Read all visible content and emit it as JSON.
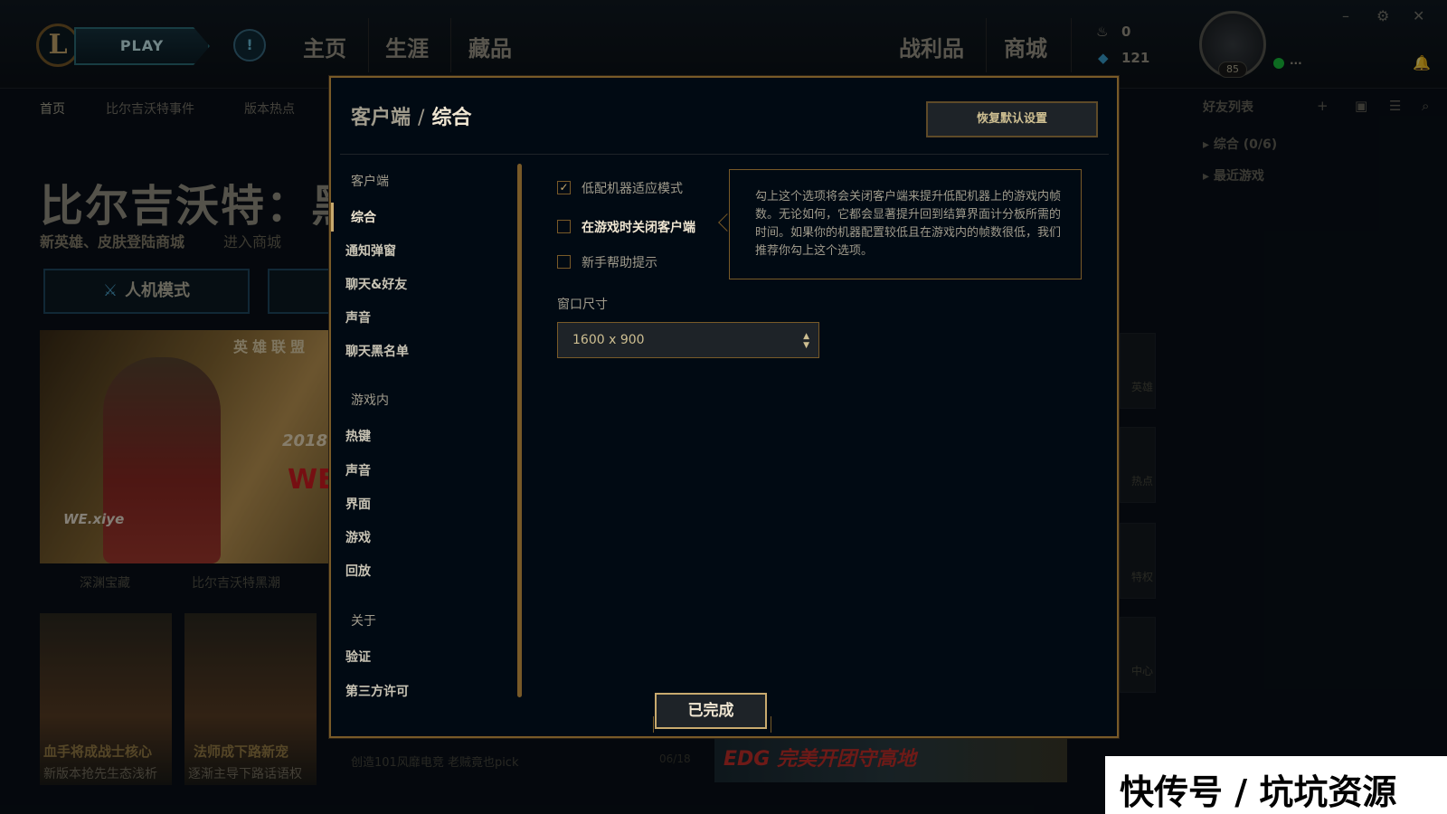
{
  "client": {
    "play_label": "PLAY",
    "alert_icon": "!",
    "nav": [
      "主页",
      "生涯",
      "藏品",
      "战利品",
      "商城"
    ],
    "currency": {
      "orange_essence": "0",
      "blue_essence": "121"
    },
    "level": "85",
    "profile_status": "...",
    "subnav": [
      "首页",
      "比尔吉沃特事件",
      "版本热点"
    ],
    "hero_title": "比尔吉沃特：黑",
    "hero_subtitle": "新英雄、皮肤登陆商城",
    "hero_link": "进入商城",
    "mode_button": "人机模式",
    "banner": {
      "logo": "英雄联盟",
      "year": "2018",
      "team": "WE",
      "player_tag": "WE.xiye"
    },
    "banner_captions": [
      "深渊宝藏",
      "比尔吉沃特黑潮"
    ],
    "tiles": [
      {
        "title": "血手将成战士核心",
        "subtitle": "新版本抢先生态浅析"
      },
      {
        "title": "法师成下路新宠",
        "subtitle": "逐渐主导下路话语权"
      }
    ],
    "news_line": "创造101风靡电竞 老贼竟也pick",
    "news_date": "06/18",
    "ad_text": "EDG 完美开团守高地",
    "friends": {
      "header": "好友列表",
      "groups": [
        "综合 (0/6)",
        "最近游戏"
      ]
    },
    "side_cards": [
      "英雄",
      "热点",
      "特权",
      "中心"
    ]
  },
  "dialog": {
    "breadcrumb_parent": "客户端",
    "breadcrumb_sep": "/",
    "breadcrumb_current": "综合",
    "reset_label": "恢复默认设置",
    "nav": {
      "client_group": "客户端",
      "client_items": [
        "综合",
        "通知弹窗",
        "聊天&好友",
        "声音",
        "聊天黑名单"
      ],
      "ingame_group": "游戏内",
      "ingame_items": [
        "热键",
        "声音",
        "界面",
        "游戏",
        "回放"
      ],
      "about_group": "关于",
      "about_items": [
        "验证",
        "第三方许可"
      ]
    },
    "options": [
      {
        "label": "低配机器适应模式",
        "checked": true
      },
      {
        "label": "在游戏时关闭客户端",
        "checked": false
      },
      {
        "label": "新手帮助提示",
        "checked": false
      }
    ],
    "tooltip": "勾上这个选项将会关闭客户端来提升低配机器上的游戏内帧数。无论如何，它都会显著提升回到结算界面计分板所需的时间。如果你的机器配置较低且在游戏内的帧数很低，我们推荐你勾上这个选项。",
    "window_size_label": "窗口尺寸",
    "window_size_value": "1600 x 900",
    "done_label": "已完成"
  },
  "watermark": "快传号 / 坑坑资源",
  "colors": {
    "gold": "#c8aa6e",
    "gold_dark": "#785a28",
    "bg": "#010a13",
    "text": "#a09b8c"
  }
}
